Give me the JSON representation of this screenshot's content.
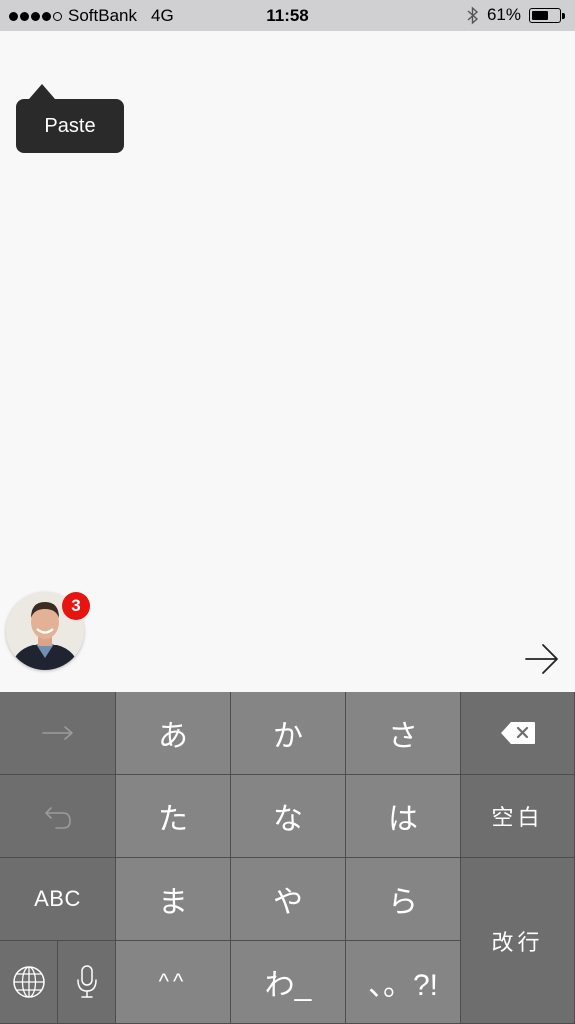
{
  "status_bar": {
    "carrier": "SoftBank",
    "network": "4G",
    "time": "11:58",
    "battery": "61%",
    "battery_level": 0.61,
    "signal_bars_filled": 4,
    "signal_bars_total": 5
  },
  "popup": {
    "paste_label": "Paste"
  },
  "avatar": {
    "badge_count": "3"
  },
  "keyboard": {
    "row1": [
      "あ",
      "か",
      "さ"
    ],
    "row2": [
      "た",
      "な",
      "は"
    ],
    "row3": [
      "ま",
      "や",
      "ら"
    ],
    "row4": [
      "^^",
      "わ_",
      "、。?!"
    ],
    "space_label": "空白",
    "return_label": "改行",
    "abc_label": "ABC"
  },
  "colors": {
    "keyboard_dark": "#6e6e6e",
    "keyboard_light": "#858585",
    "badge": "#e8140f",
    "popup": "#2a2a2a"
  }
}
